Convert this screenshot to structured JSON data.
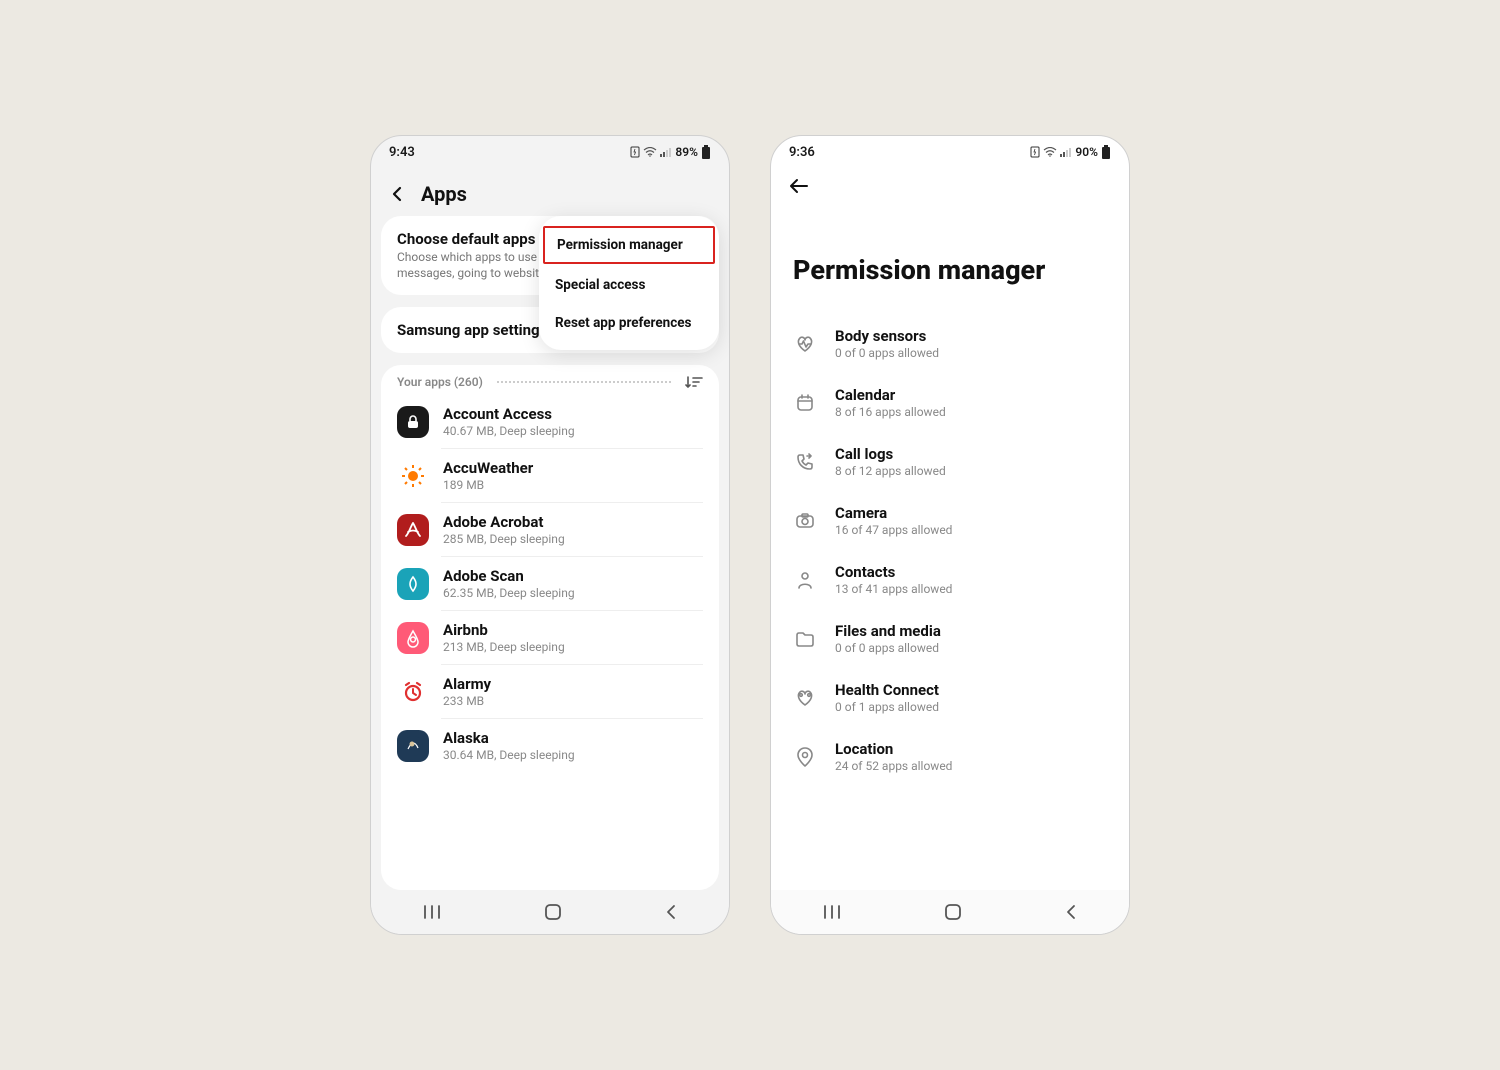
{
  "left": {
    "status": {
      "time": "9:43",
      "battery_text": "89%"
    },
    "header": {
      "title": "Apps"
    },
    "default_apps": {
      "title": "Choose default apps",
      "subtitle": "Choose which apps to use for making calls, sending messages, going to websites, and more."
    },
    "samsung_settings": {
      "title": "Samsung app settings"
    },
    "your_apps_label": "Your apps (260)",
    "dropdown": {
      "items": [
        "Permission manager",
        "Special access",
        "Reset app preferences"
      ]
    },
    "apps": [
      {
        "name": "Account Access",
        "sub": "40.67 MB, Deep sleeping",
        "bg": "#1a1a1a",
        "icon": "lock"
      },
      {
        "name": "AccuWeather",
        "sub": "189 MB",
        "bg": "#ffffff",
        "icon": "sun"
      },
      {
        "name": "Adobe Acrobat",
        "sub": "285 MB, Deep sleeping",
        "bg": "#b11d1d",
        "icon": "acrobat"
      },
      {
        "name": "Adobe Scan",
        "sub": "62.35 MB, Deep sleeping",
        "bg": "#1aa3b8",
        "icon": "scan"
      },
      {
        "name": "Airbnb",
        "sub": "213 MB, Deep sleeping",
        "bg": "#ff5a77",
        "icon": "airbnb"
      },
      {
        "name": "Alarmy",
        "sub": "233 MB",
        "bg": "#ffffff",
        "icon": "alarmy"
      },
      {
        "name": "Alaska",
        "sub": "30.64 MB, Deep sleeping",
        "bg": "#1f3a56",
        "icon": "alaska"
      }
    ]
  },
  "right": {
    "status": {
      "time": "9:36",
      "battery_text": "90%"
    },
    "title": "Permission manager",
    "permissions": [
      {
        "name": "Body sensors",
        "sub": "0 of 0 apps allowed",
        "icon": "heart"
      },
      {
        "name": "Calendar",
        "sub": "8 of 16 apps allowed",
        "icon": "calendar"
      },
      {
        "name": "Call logs",
        "sub": "8 of 12 apps allowed",
        "icon": "phone"
      },
      {
        "name": "Camera",
        "sub": "16 of 47 apps allowed",
        "icon": "camera"
      },
      {
        "name": "Contacts",
        "sub": "13 of 41 apps allowed",
        "icon": "contact"
      },
      {
        "name": "Files and media",
        "sub": "0 of 0 apps allowed",
        "icon": "folder"
      },
      {
        "name": "Health Connect",
        "sub": "0 of 1 apps allowed",
        "icon": "health"
      },
      {
        "name": "Location",
        "sub": "24 of 52 apps allowed",
        "icon": "location"
      }
    ]
  }
}
